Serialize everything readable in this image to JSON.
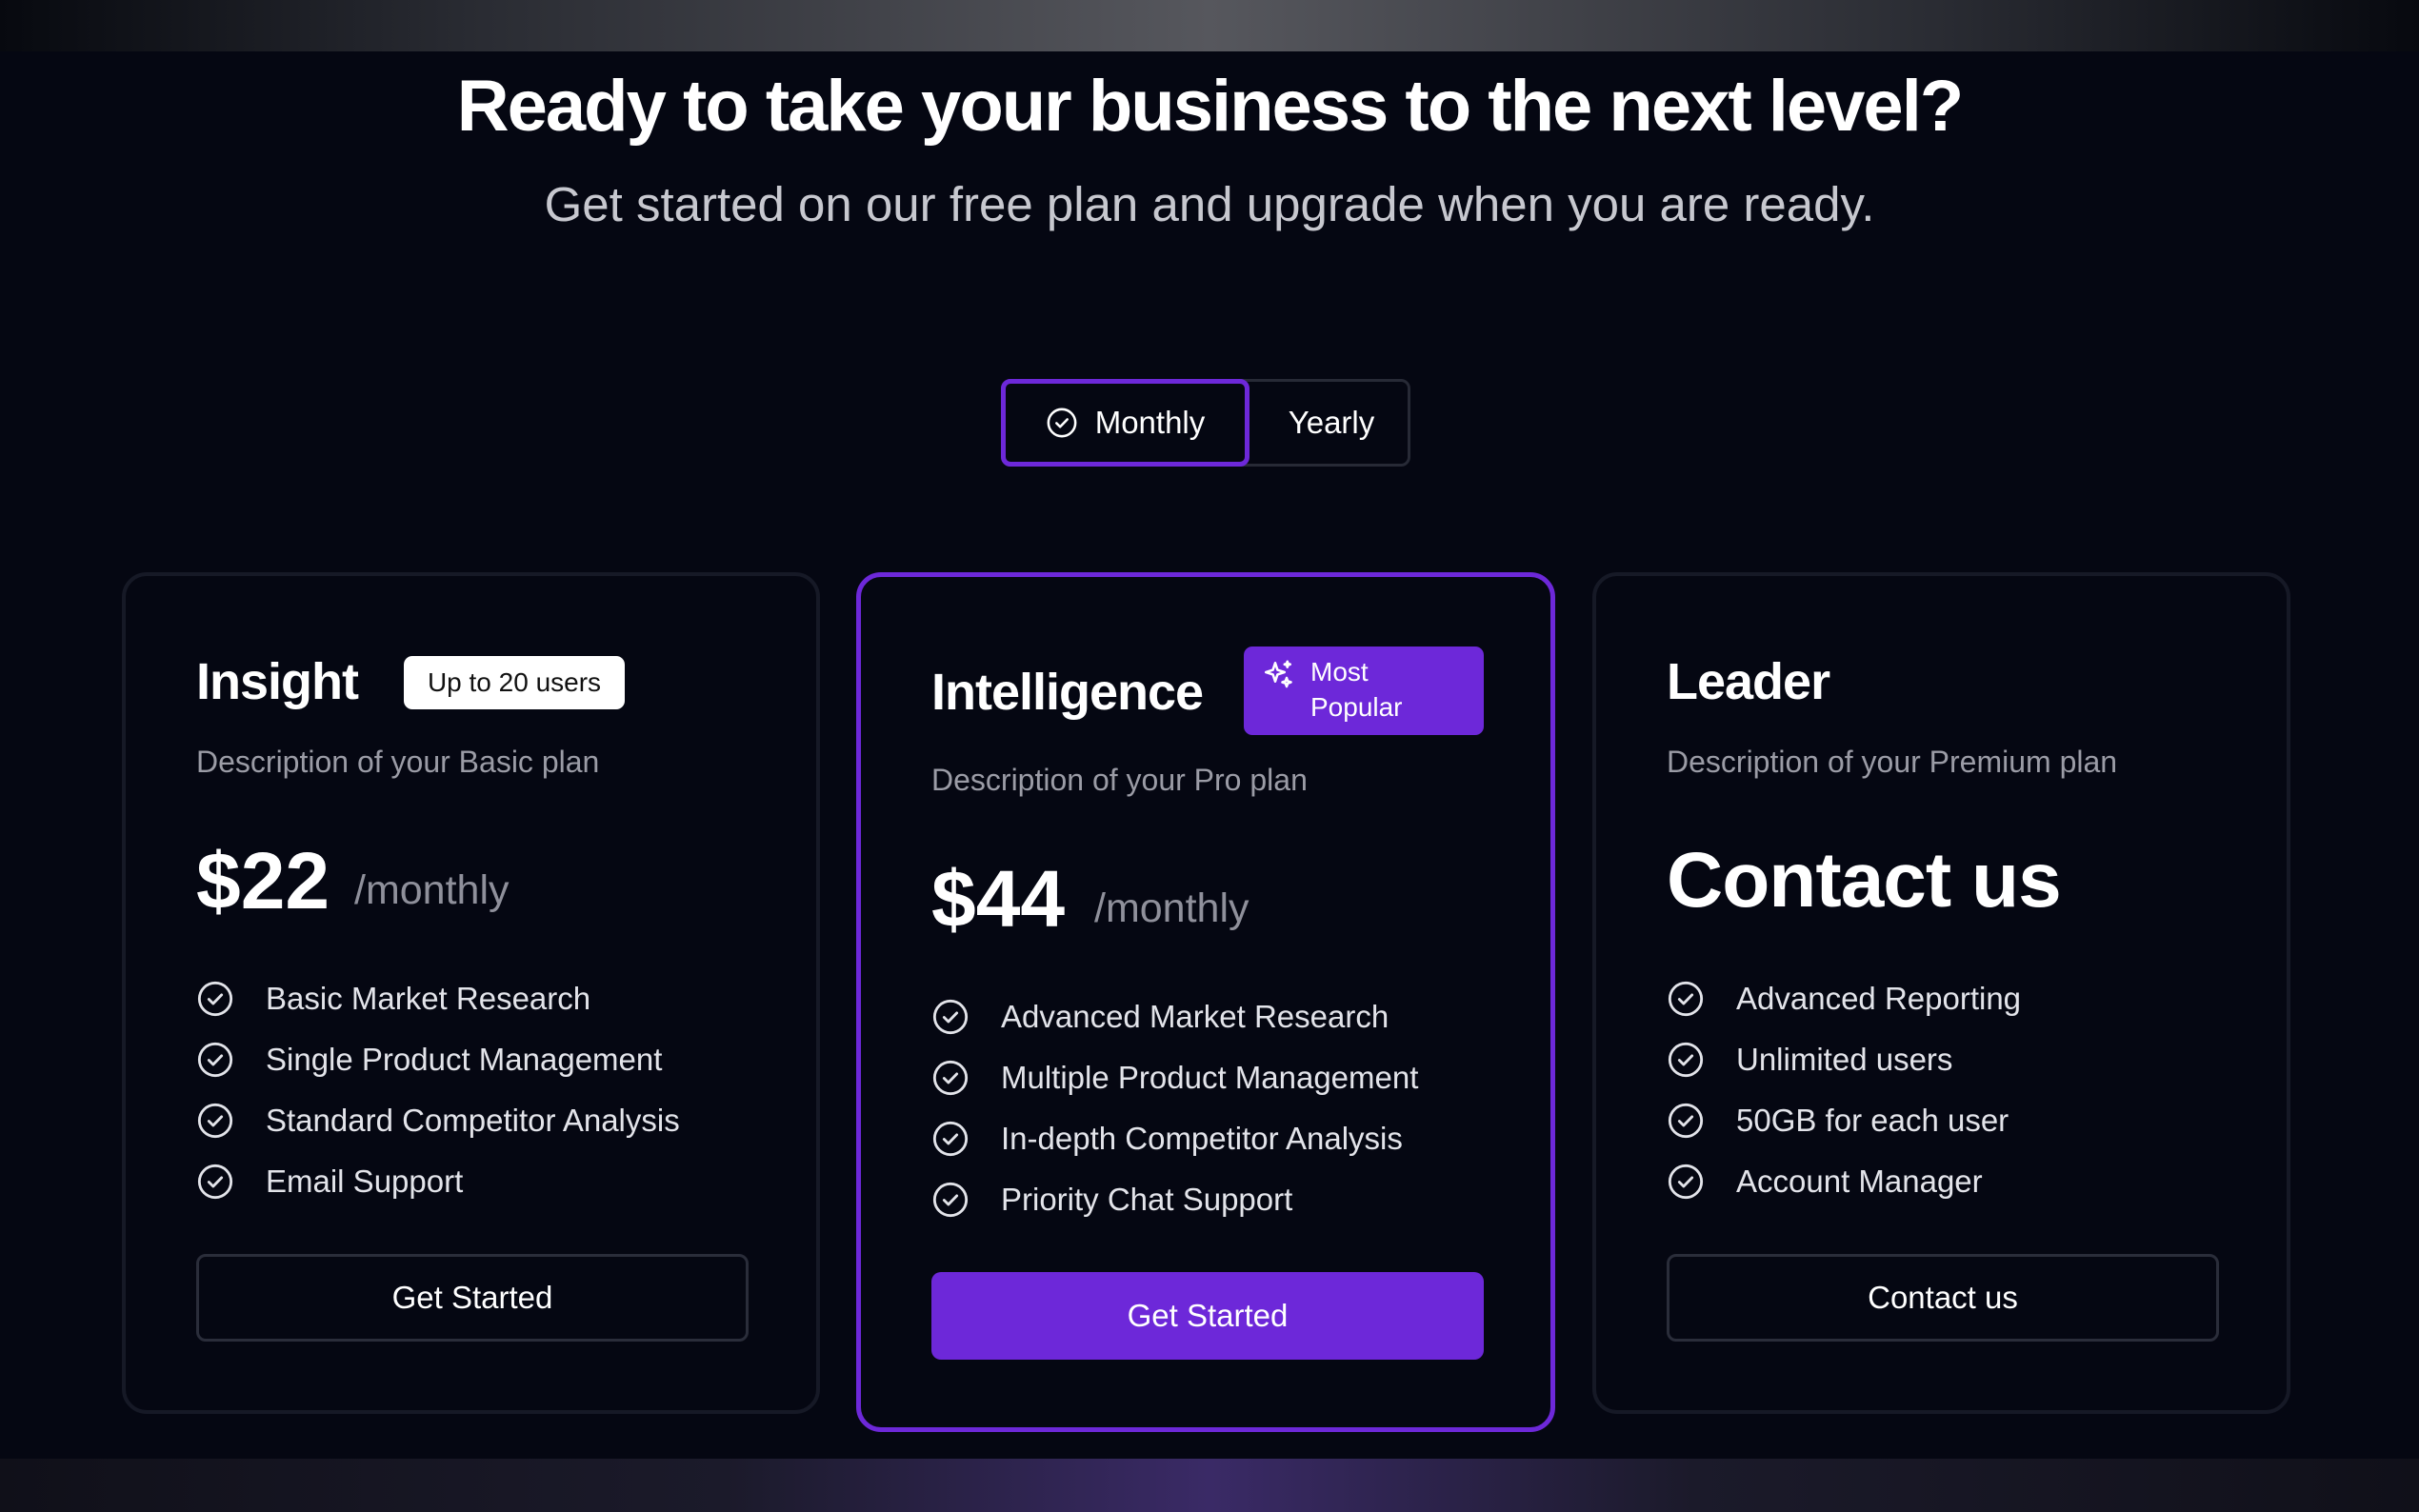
{
  "header": {
    "title": "Ready to take your business to the next level?",
    "subtitle": "Get started on our free plan and upgrade when you are ready."
  },
  "billing_toggle": {
    "monthly_label": "Monthly",
    "yearly_label": "Yearly",
    "selected": "Monthly",
    "selected_icon": "check-circle-icon"
  },
  "colors": {
    "background": "#050712",
    "accent": "#6d28d9",
    "card_border": "#161926",
    "muted_text": "#9b9ca6"
  },
  "plans": [
    {
      "name": "Insight",
      "badge": "Up to 20 users",
      "description": "Description of your Basic plan",
      "price": "$22",
      "period": "/monthly",
      "features": [
        "Basic Market Research",
        "Single Product Management",
        "Standard Competitor Analysis",
        "Email Support"
      ],
      "feature_icon": "check-circle-icon",
      "cta": "Get Started",
      "cta_style": "outline"
    },
    {
      "name": "Intelligence",
      "badge": "Most Popular",
      "badge_icon": "sparkles-icon",
      "highlighted": true,
      "description": "Description of your Pro plan",
      "price": "$44",
      "period": "/monthly",
      "features": [
        "Advanced Market Research",
        "Multiple Product Management",
        "In-depth Competitor Analysis",
        "Priority Chat Support"
      ],
      "feature_icon": "check-circle-icon",
      "cta": "Get Started",
      "cta_style": "primary"
    },
    {
      "name": "Leader",
      "description": "Description of your Premium plan",
      "price": "Contact us",
      "features": [
        "Advanced Reporting",
        "Unlimited users",
        "50GB for each user",
        "Account Manager"
      ],
      "feature_icon": "check-circle-icon",
      "cta": "Contact us",
      "cta_style": "outline"
    }
  ]
}
